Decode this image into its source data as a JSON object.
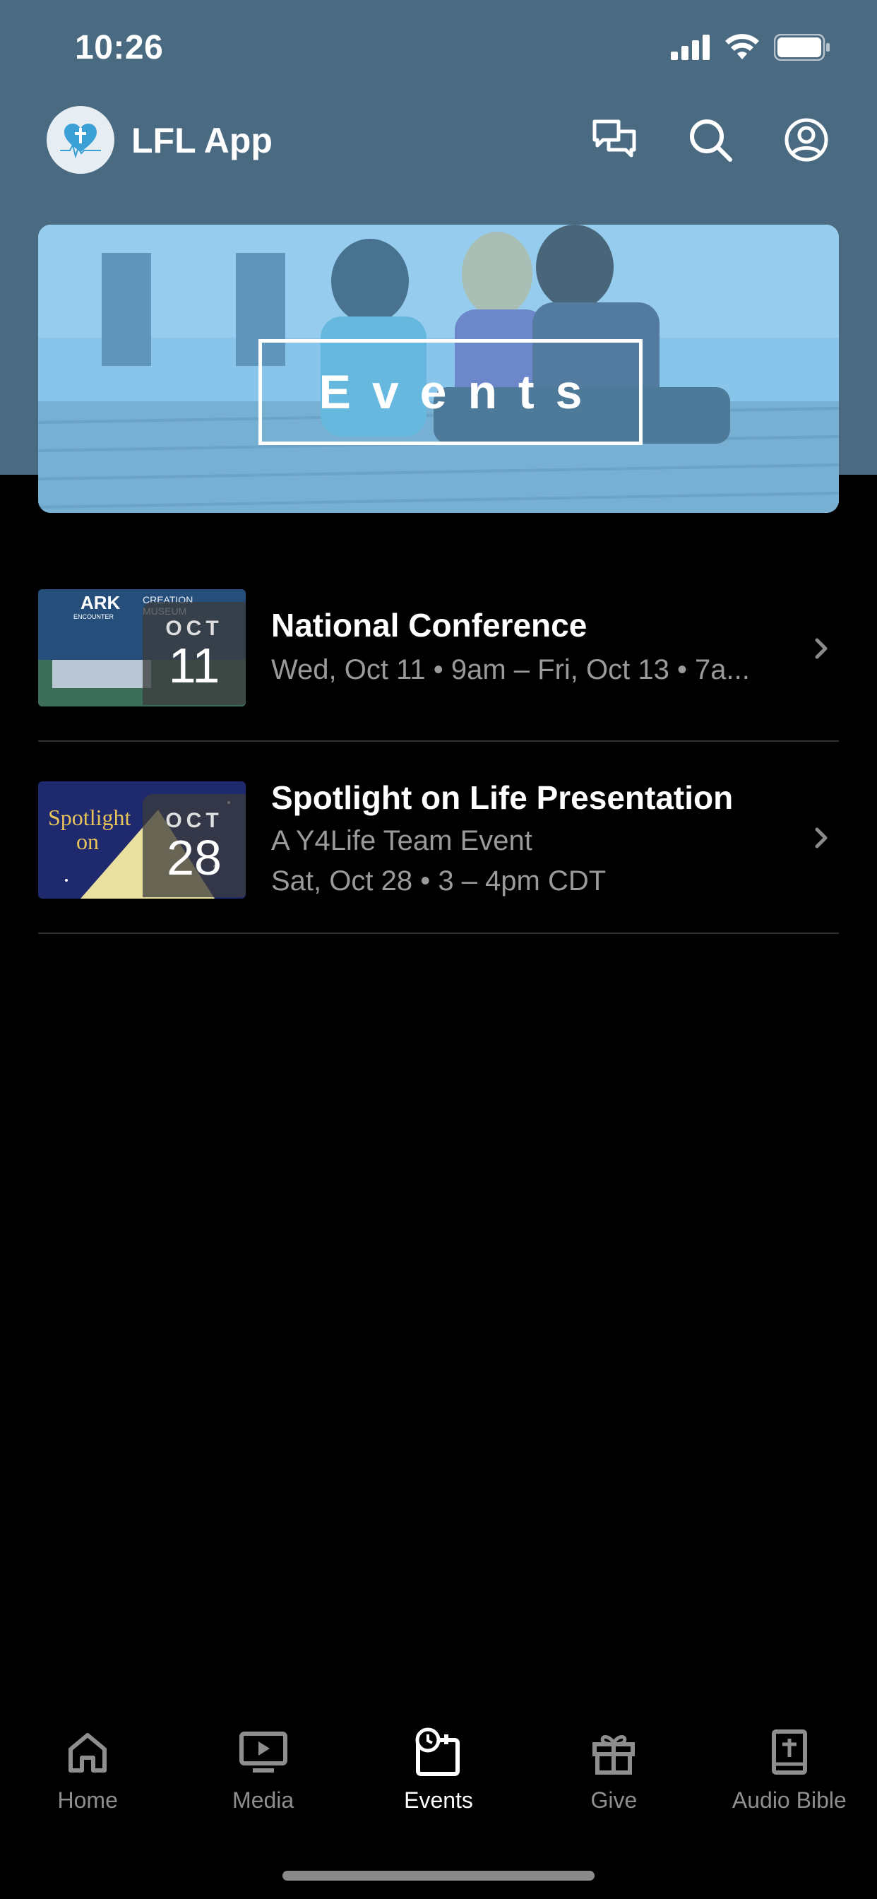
{
  "status_bar": {
    "time": "10:26"
  },
  "app": {
    "title": "LFL App",
    "logo_icon": "heart-cross-logo-icon"
  },
  "header_actions": [
    {
      "name": "chat-icon"
    },
    {
      "name": "search-icon"
    },
    {
      "name": "profile-icon"
    }
  ],
  "banner": {
    "title": "Events"
  },
  "events": [
    {
      "title": "National Conference",
      "subtitle": "Wed, Oct 11 • 9am – Fri, Oct 13 • 7a...",
      "month": "OCT",
      "day": "11",
      "thumb_text": [
        "ARK",
        "ENCOUNTER",
        "CREATION",
        "MUSEUM"
      ]
    },
    {
      "title": "Spotlight on Life Presentation",
      "subtitle": "A Y4Life Team Event",
      "when": "Sat, Oct 28 • 3 – 4pm CDT",
      "month": "OCT",
      "day": "28",
      "thumb_text": [
        "Spotlight",
        "on"
      ]
    }
  ],
  "tabs": [
    {
      "label": "Home",
      "icon": "home-icon",
      "active": false
    },
    {
      "label": "Media",
      "icon": "media-icon",
      "active": false
    },
    {
      "label": "Events",
      "icon": "events-icon",
      "active": true
    },
    {
      "label": "Give",
      "icon": "gift-icon",
      "active": false
    },
    {
      "label": "Audio Bible",
      "icon": "bible-icon",
      "active": false
    }
  ],
  "colors": {
    "header": "#4a6a82",
    "background": "#000000",
    "accent_inactive": "#8e8e8e"
  }
}
